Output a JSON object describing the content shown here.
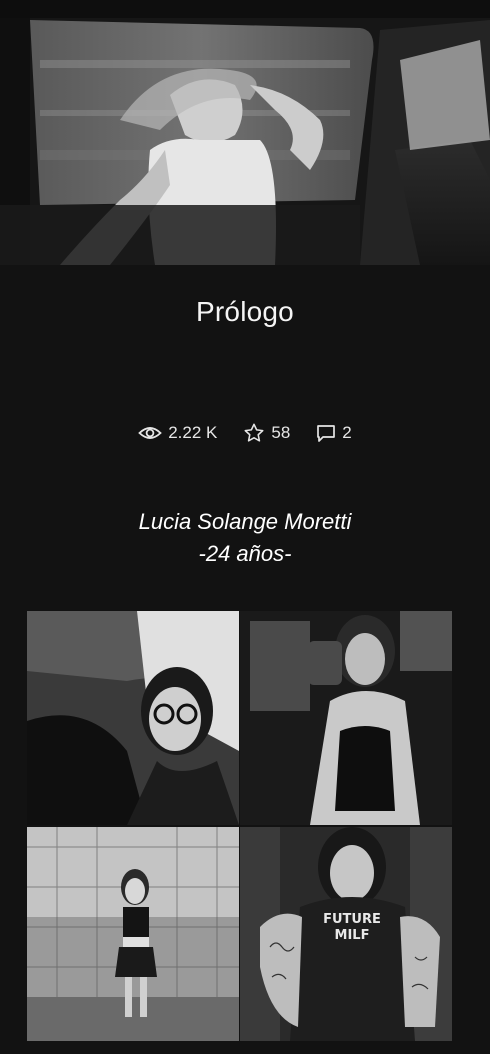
{
  "chapter": {
    "title": "Prólogo"
  },
  "stats": {
    "views": "2.22 K",
    "votes": "58",
    "comments": "2"
  },
  "content": {
    "character_name": "Lucia Solange Moretti",
    "character_age": "-24 años-"
  },
  "collage_images": [
    {
      "icon": "photo"
    },
    {
      "icon": "photo"
    },
    {
      "icon": "photo"
    },
    {
      "icon": "photo"
    }
  ],
  "graphic_text": {
    "shirt_print": "FUTURE MILF"
  },
  "colors": {
    "background": "#121212",
    "text": "#f2f2f2",
    "icon": "#e6e6e6"
  }
}
